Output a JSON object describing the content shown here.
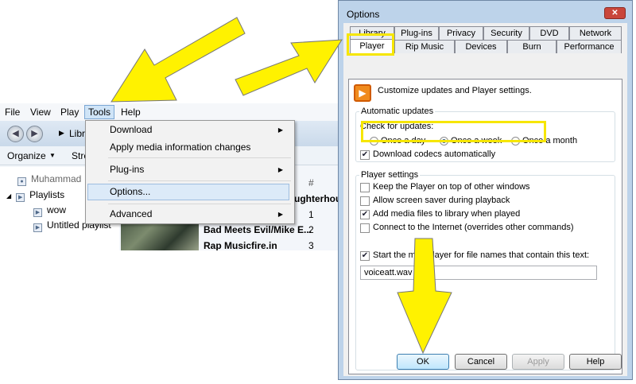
{
  "player": {
    "menu": {
      "file": "File",
      "view": "View",
      "play": "Play",
      "tools": "Tools",
      "help": "Help"
    },
    "nav": {
      "breadcrumb": "Libr"
    },
    "toolbar": {
      "organize": "Organize",
      "stream": "Stre"
    },
    "column_header": "#",
    "partial_header": "laughterhou",
    "tree": {
      "root": "Muhammad",
      "playlists": "Playlists",
      "items": [
        "wow",
        "Untitled playlist"
      ]
    },
    "tracks": [
      {
        "title": "Bad Meets Evil/Mike E...",
        "num": "2"
      },
      {
        "title": "Rap Musicfire.in",
        "num": "3"
      }
    ],
    "first_num": "1",
    "tools_menu": {
      "download": "Download",
      "apply_media": "Apply media information changes",
      "plugins": "Plug-ins",
      "options": "Options...",
      "advanced": "Advanced"
    }
  },
  "dialog": {
    "title": "Options",
    "close": "✕",
    "tabs_row1": [
      "Library",
      "Plug-ins",
      "Privacy",
      "Security",
      "DVD",
      "Network"
    ],
    "tabs_row2": [
      "Player",
      "Rip Music",
      "Devices",
      "Burn",
      "Performance"
    ],
    "header_text": "Customize updates and Player settings.",
    "auto_updates": {
      "legend": "Automatic updates",
      "check_label": "Check for updates:",
      "options": [
        "Once a day",
        "Once a week",
        "Once a month"
      ],
      "selected": "Once a week",
      "download_codecs": "Download codecs automatically"
    },
    "player_settings": {
      "legend": "Player settings",
      "items": [
        {
          "label": "Keep the Player on top of other windows",
          "checked": false
        },
        {
          "label": "Allow screen saver during playback",
          "checked": false
        },
        {
          "label": "Add media files to library when played",
          "checked": true
        },
        {
          "label": "Connect to the Internet (overrides other commands)",
          "checked": false
        }
      ],
      "mini_player": "Start the mini Player for file names that contain this text:",
      "mini_player_value": "voiceatt.wav"
    },
    "buttons": {
      "ok": "OK",
      "cancel": "Cancel",
      "apply": "Apply",
      "help": "Help"
    }
  },
  "colors": {
    "highlight": "#f6e600",
    "arrow": "#fff200",
    "accent": "#3c7fb1"
  }
}
